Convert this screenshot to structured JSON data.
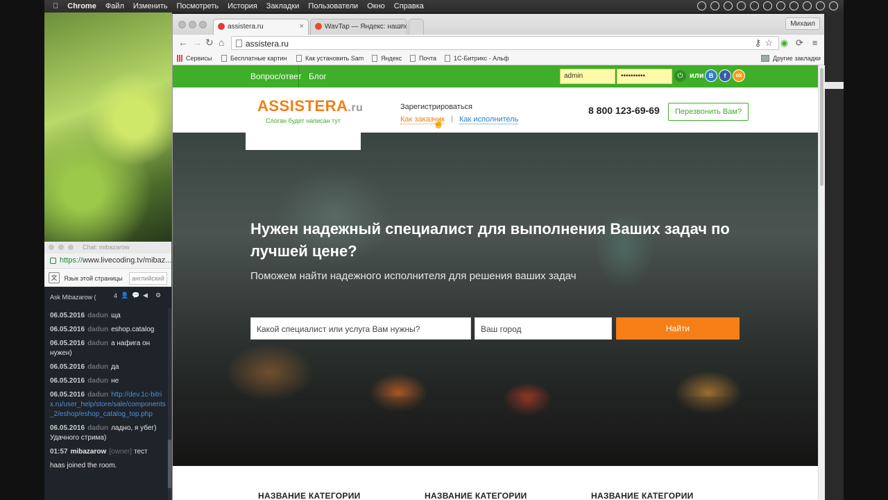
{
  "menubar": {
    "app": "Chrome",
    "items": [
      "Файл",
      "Изменить",
      "Посмотреть",
      "История",
      "Закладки",
      "Пользователи",
      "Окно",
      "Справка"
    ]
  },
  "browser": {
    "tabs": [
      {
        "title": "assistera.ru",
        "active": true
      },
      {
        "title": "WavTap — Яндекс: нашлос",
        "active": false
      }
    ],
    "profile": "Михаил",
    "url": "assistera.ru",
    "bookmarks": [
      "Сервисы",
      "Бесплатные картин",
      "Как установить Sam",
      "Яндекс",
      "Почта",
      "1С-Битрикс - Альф"
    ],
    "other_bookmarks": "Другие закладки"
  },
  "site": {
    "topnav": {
      "qa": "Вопрос/ответ",
      "blog": "Блог"
    },
    "login": {
      "username": "admin",
      "password": "••••••••••",
      "or": "или"
    },
    "social": [
      {
        "label": "В",
        "color": "#2f7ec9"
      },
      {
        "label": "f",
        "color": "#3b5ca0"
      },
      {
        "label": "ok",
        "color": "#f59a1b"
      }
    ],
    "logo": {
      "main": "ASSISTERA",
      "suffix": ".ru",
      "slogan": "Слоган будет написан тут"
    },
    "register": {
      "title": "Зарегистрироваться",
      "client": "Как заказчик",
      "contractor": "Как исполнитель"
    },
    "phone": "8 800 123-69-69",
    "callback": "Перезвонить Вам?",
    "hero": {
      "title": "Нужен надежный специалист для выполнения Ваших задач по лучшей цене?",
      "subtitle": "Поможем найти надежного исполнителя для решения ваших задач",
      "service_placeholder": "Какой специалист или услуга Вам нужны?",
      "city_placeholder": "Ваш город",
      "search_button": "Найти"
    },
    "categories": [
      "НАЗВАНИЕ КАТЕГОРИИ",
      "НАЗВАНИЕ КАТЕГОРИИ",
      "НАЗВАНИЕ КАТЕГОРИИ"
    ]
  },
  "chat": {
    "window_title": "Chat: mibazarow",
    "url_secure": "https://",
    "url_rest": "www.livecoding.tv/mibaz...",
    "translate_label": "Язык этой страницы",
    "translate_lang": "английский",
    "header": "Ask Mibazarow (",
    "viewer_count": "4",
    "messages": [
      {
        "date": "06.05.2016",
        "user": "dadun",
        "text": "ща"
      },
      {
        "date": "06.05.2016",
        "user": "dadun",
        "text": "eshop.catalog"
      },
      {
        "date": "06.05.2016",
        "user": "dadun",
        "text": "а нафига он нужен)"
      },
      {
        "date": "06.05.2016",
        "user": "dadun",
        "text": "да"
      },
      {
        "date": "06.05.2016",
        "user": "dadun",
        "text": "не"
      },
      {
        "date": "06.05.2016",
        "user": "dadun",
        "link": "http://dev.1c-bitrix.ru/user_help/store/sale/components_2/eshop/eshop_catalog_top.php"
      },
      {
        "date": "06.05.2016",
        "user": "dadun",
        "text": "ладно, я убег) Удачного стрима)"
      },
      {
        "date": "01:57",
        "user": "mibazarow",
        "role": "[owner]",
        "text": "тест"
      },
      {
        "text": "haas joined the room."
      }
    ]
  }
}
